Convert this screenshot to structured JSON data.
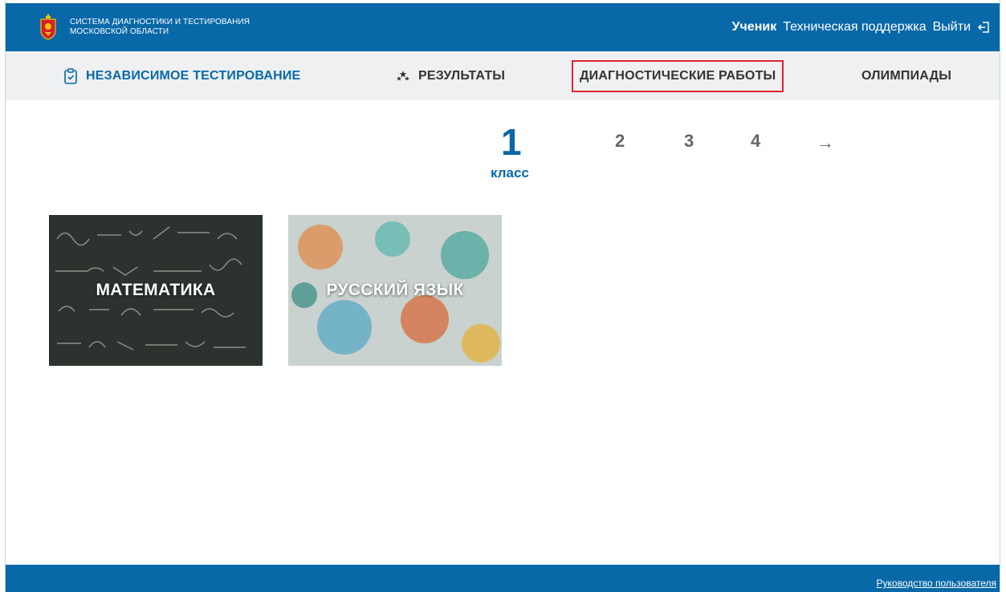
{
  "header": {
    "system_title_line1": "СИСТЕМА ДИАГНОСТИКИ И ТЕСТИРОВАНИЯ",
    "system_title_line2": "МОСКОВСКОЙ ОБЛАСТИ",
    "role": "Ученик",
    "support_link": "Техническая поддержка",
    "logout_link": "Выйти",
    "logout_icon": "exit-icon",
    "emblem_icon": "coat-of-arms-icon"
  },
  "nav": {
    "items": [
      {
        "label": "НЕЗАВИСИМОЕ ТЕСТИРОВАНИЕ",
        "icon": "clipboard-icon",
        "active": true
      },
      {
        "label": "РЕЗУЛЬТАТЫ",
        "icon": "stars-icon",
        "active": false
      },
      {
        "label": "ДИАГНОСТИЧЕСКИЕ РАБОТЫ",
        "highlighted": true
      },
      {
        "label": "ОЛИМПИАДЫ"
      }
    ]
  },
  "grades": {
    "selected": "1",
    "selected_caption": "класс",
    "others": [
      "2",
      "3",
      "4"
    ],
    "next_arrow": "→"
  },
  "subjects": [
    {
      "label": "МАТЕМАТИКА"
    },
    {
      "label": "РУССКИЙ ЯЗЫК"
    }
  ],
  "footer": {
    "manual_link": "Руководство пользователя"
  },
  "colors": {
    "primary": "#0868a8",
    "nav_bg": "#eef0f2",
    "highlight_border": "#e0252f"
  }
}
